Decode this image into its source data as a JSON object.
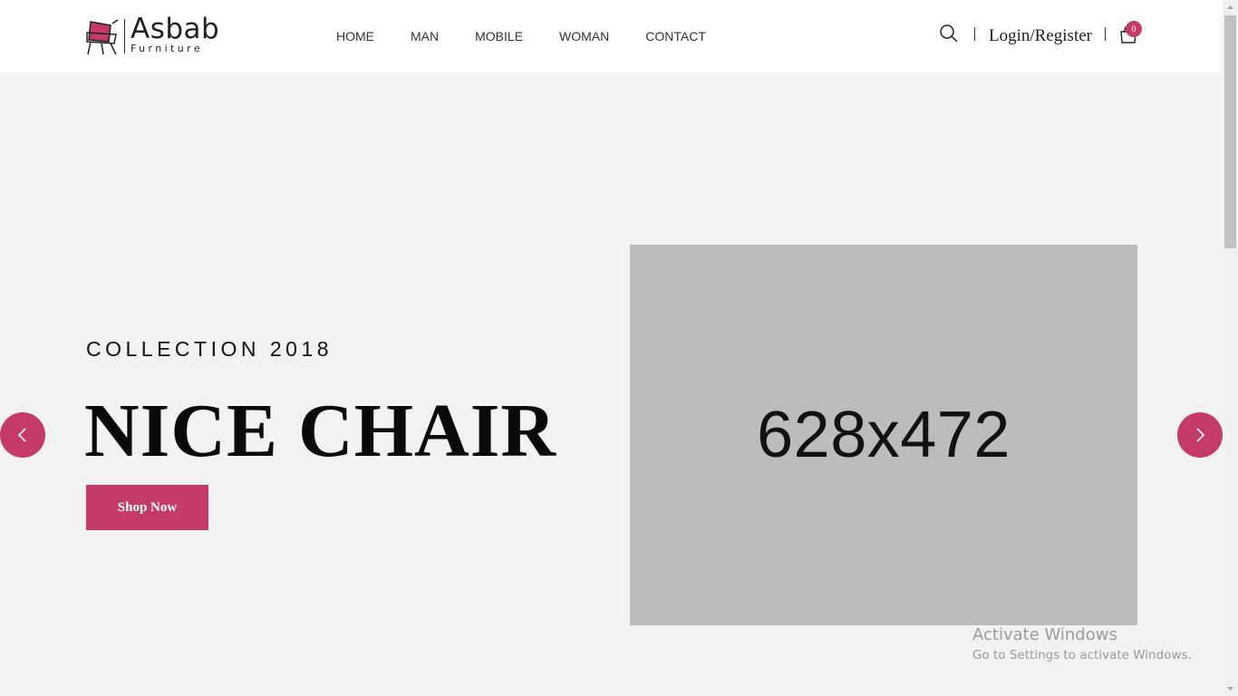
{
  "brand": {
    "name": "Asbab",
    "tagline": "Furniture",
    "accent_color": "#c43b68"
  },
  "nav": {
    "items": [
      {
        "label": "HOME"
      },
      {
        "label": "MAN"
      },
      {
        "label": "MOBILE"
      },
      {
        "label": "WOMAN"
      },
      {
        "label": "CONTACT"
      }
    ]
  },
  "header": {
    "search_icon": "search-icon",
    "login_label": "Login/Register",
    "cart_icon": "shopping-bag-icon",
    "cart_count": "0"
  },
  "hero": {
    "subtitle": "COLLECTION 2018",
    "title": "NICE CHAIR",
    "button_label": "Shop Now",
    "image_placeholder": "628x472",
    "prev_icon": "chevron-left-icon",
    "next_icon": "chevron-right-icon"
  },
  "watermark": {
    "title": "Activate Windows",
    "subtitle": "Go to Settings to activate Windows."
  }
}
